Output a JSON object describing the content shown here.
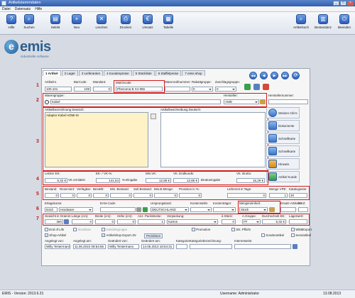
{
  "window": {
    "title": "Artikelstammdaten",
    "controls": [
      "_",
      "□",
      "×"
    ]
  },
  "menu": [
    "Datei",
    "Datensatz",
    "Hilfe"
  ],
  "toolbar": {
    "items": [
      {
        "label": "Hilfe",
        "icon": "help-icon"
      },
      {
        "label": "Suchen",
        "icon": "search-icon"
      },
      {
        "label": "Selekt",
        "icon": "select-icon"
      },
      {
        "label": "Neu",
        "icon": "new-icon"
      },
      {
        "label": "Löschen",
        "icon": "delete-icon"
      },
      {
        "label": "Drucken",
        "icon": "print-icon"
      },
      {
        "label": "Umsatz",
        "icon": "sales-icon"
      },
      {
        "label": "Tabelle",
        "icon": "table-icon"
      }
    ],
    "right_items": [
      {
        "label": "Artikelsuch",
        "icon": "article-search-icon"
      },
      {
        "label": "Bestandanz",
        "icon": "stock-display-icon"
      },
      {
        "label": "Beenden",
        "icon": "exit-icon"
      }
    ]
  },
  "logo": {
    "text": "emis",
    "sub": "industrielle software"
  },
  "tabs": [
    "1 Artikel",
    "2 Lager",
    "3 Lieferanten",
    "4 Kundenpreise",
    "5 Stückliste",
    "6 Staffelpreise",
    "7 emis.shop"
  ],
  "nav_icons": [
    "◀◀",
    "◀",
    "▶",
    "▶▶",
    "⟳"
  ],
  "sections": {
    "s1": "1",
    "s2": "2",
    "s3": "3",
    "s4": "4",
    "s5": "5",
    "s6": "6",
    "s7": "7"
  },
  "row1": {
    "labels": {
      "artikelnr": "Artikelnr.",
      "barcode": "BarCode:",
      "mandant": "Mandant:",
      "matchcode": "Matchcode:",
      "warenzoll": "Warenzollnummer:",
      "rabattgruppe": "Rabattgruppe:",
      "zuschlag": "Zuschlagsgruppe:"
    },
    "values": {
      "artikelnr": "100.101",
      "barcode": "109",
      "mandant": "0",
      "matchcode": "Phenoma B X4 955",
      "warenzoll": "",
      "rabattgruppe": "0",
      "zuschlag": "0"
    }
  },
  "row2": {
    "labels": {
      "warengruppe": "Warengruppe:",
      "hersteller": "Hersteller:",
      "herstellernr": "Herstellernummer:"
    },
    "values": {
      "warengruppe": "Kabel",
      "hersteller": "AMD",
      "herstellernr": ""
    }
  },
  "descriptions": {
    "label_de": "Artikelbezeichnung Deutsch:",
    "value_de": "Adapter-Kabel HDMI-M",
    "label_beschr": "Artikelbeschreibung Deutsch:",
    "value_beschr": ""
  },
  "side_buttons": [
    {
      "label": "Weitere Info's",
      "icon": "info-icon"
    },
    {
      "label": "Dokumente",
      "icon": "documents-icon"
    },
    {
      "label": "Schnellkarte",
      "icon": "quickcard-icon"
    },
    {
      "label": "Schnellkarte",
      "icon": "quickcard-icon-2"
    },
    {
      "label": "Hinweis",
      "icon": "notice-icon"
    },
    {
      "label": "Artikel Kunde",
      "icon": "customer-article-icon"
    }
  ],
  "prices": {
    "labels": {
      "letzter_ek": "Letzter EK:",
      "ek_vk": "EK- / VK-%:",
      "min_vk": "Min.VK:",
      "vk_endkunde": "VK. Endkunde:",
      "vk_brutto": "VK. Brutto:"
    },
    "values": {
      "letzter_ek": "5,32 €",
      "ek_vk": "141,54",
      "min_vk": "12,85 €",
      "vk_endkunde": "12,85 €",
      "vk_brutto": "15,29 €"
    },
    "buttons": {
      "vk_ermitteln": "VK ermitteln",
      "prz_eingabe": "%-Eingabe",
      "brutto_eingabe": "Bruttoeingabe"
    }
  },
  "stock": {
    "labels": [
      "Bestand:",
      "Reserviert:",
      "Verfügbar:",
      "Bestellt:",
      "Min. Bestand:",
      "Soll Bestand:",
      "Min.B.Menge:",
      "Provision in %:",
      "Lieferzeit in Tage:",
      "Menge VPE:",
      "Katalogseite:"
    ],
    "values": [
      "0",
      "0",
      "0",
      "0",
      "0",
      "0",
      "0",
      "0",
      "0",
      "1",
      "20"
    ]
  },
  "origin": {
    "labels": {
      "erlagskonto": "Erlagskonto:",
      "ean": "EAN-Code:",
      "ursprung": "Ursprungsland:",
      "kostenstelle": "Kostenstelle:",
      "kostentraeger": "Kostenträger:",
      "mengeneinheit": "Mengeneinheit:",
      "ersatz": "Ersatz-Artikeln:",
      "mkz": "MKZ:"
    },
    "values": {
      "erlagskonto": "8410",
      "erlagskonto_text": "Hardware",
      "ean": "",
      "ursprung": "DEUTSCHLAND",
      "kostenstelle": "",
      "kostentraeger": "",
      "mengeneinheit": "Stück",
      "ersatz": "",
      "mkz": ""
    }
  },
  "packaging": {
    "labels": {
      "gewicht": "Gewicht in Gramm:",
      "laenge": "Länge (cm):",
      "breite": "Breite (cm):",
      "hoehe": "Höhe (cm):",
      "anz_pack": "Anz. Packstücke:",
      "verpackung": "Verpackung:",
      "stueck": "à Stück:",
      "agruppe": "A.Gruppe:",
      "durchschnitt": "Durchschnitt EK:",
      "lagerwert": "Lagerwert:"
    },
    "values": {
      "gewicht": "360",
      "laenge": "0",
      "breite": "0",
      "hoehe": "0",
      "anz_pack": "1",
      "verpackung": "Karton",
      "stueck": "0",
      "agruppe": "FF",
      "durchschnitt": "5,32 €",
      "lagerwert": ""
    }
  },
  "checks": [
    {
      "label": "End of Life",
      "checked": false
    },
    {
      "label": "Stockliste",
      "checked": false
    },
    {
      "label": "Handelsgruppe",
      "checked": false
    },
    {
      "label": "Promotion",
      "checked": false
    },
    {
      "label": "SN. Pflicht",
      "checked": false
    },
    {
      "label": "WEBExport",
      "checked": false
    },
    {
      "label": "Shop-Artikel",
      "checked": true
    },
    {
      "label": "Artikelshop Export JN",
      "checked": true
    },
    {
      "label": "Preislisten",
      "checked": false
    },
    {
      "label": "Sonderartikel",
      "checked": false
    },
    {
      "label": "Serviartikel",
      "checked": false
    }
  ],
  "audit": {
    "labels": {
      "angelegt_von": "Angelegt von:",
      "angelegt_am": "Angelegt am:",
      "geaendert_von": "Geändert von:",
      "geaendert_am": "Geändert am:",
      "kategorie": "Kategorie:",
      "kategoriebezeichnung": "Kategoriebezeichnung:",
      "internetseite": "Internetseite:"
    },
    "values": {
      "angelegt_von": "Willy Testermann",
      "angelegt_am": "11.06.2010 09:54:56",
      "geaendert_von": "Willy Testermann",
      "geaendert_am": "14.05.2013 18:54:31",
      "kategorie": "",
      "kategoriebezeichnung": "",
      "internetseite": ""
    }
  },
  "status": {
    "version": "EMIS - Version: 2013.6.31",
    "user": "Username: Administrator",
    "date": "13.08.2013"
  }
}
